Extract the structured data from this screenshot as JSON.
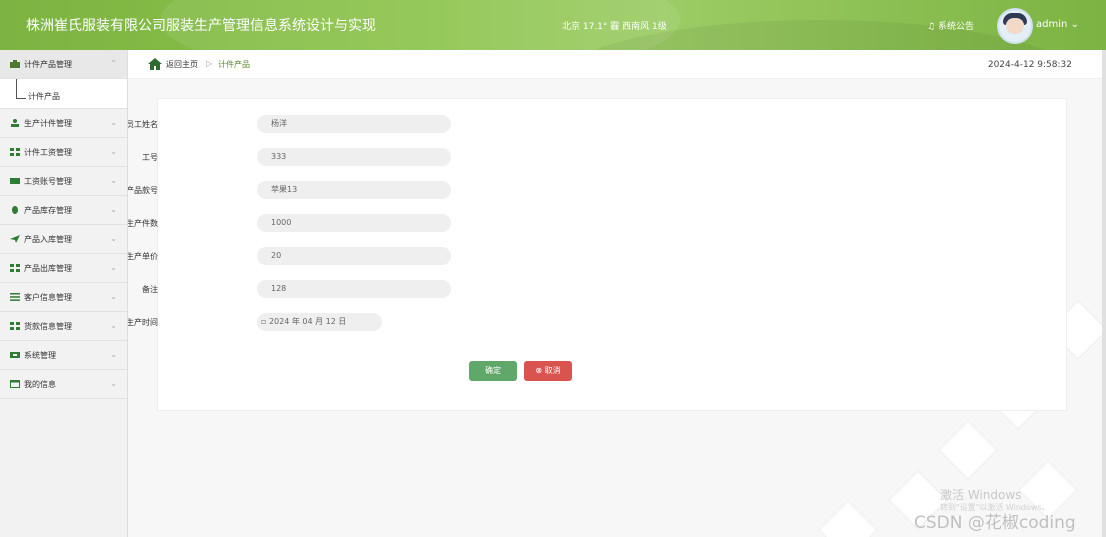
{
  "header": {
    "title": "株洲崔氏服装有限公司服装生产管理信息系统设计与实现",
    "weather": "北京  17.1°  霾  西南风  1级",
    "notice": "系统公告",
    "user": "admin ⌄"
  },
  "sidebar": {
    "items": [
      {
        "label": "计件产品管理",
        "icon": "product-icon",
        "color": "#4a7a2a"
      },
      {
        "label": "生产计件管理",
        "icon": "person-icon",
        "color": "#2e7d32"
      },
      {
        "label": "计件工资管理",
        "icon": "grid-icon",
        "color": "#2e7d32"
      },
      {
        "label": "工资账号管理",
        "icon": "card-icon",
        "color": "#2e7d32"
      },
      {
        "label": "产品库存管理",
        "icon": "leaf-icon",
        "color": "#2e7d32"
      },
      {
        "label": "产品入库管理",
        "icon": "send-icon",
        "color": "#2e7d32"
      },
      {
        "label": "产品出库管理",
        "icon": "grid-icon",
        "color": "#2e7d32"
      },
      {
        "label": "客户信息管理",
        "icon": "list-icon",
        "color": "#2e7d32"
      },
      {
        "label": "货款信息管理",
        "icon": "grid-icon",
        "color": "#2e7d32"
      },
      {
        "label": "系统管理",
        "icon": "settings-icon",
        "color": "#2e7d32"
      },
      {
        "label": "我的信息",
        "icon": "info-icon",
        "color": "#2e7d32"
      }
    ],
    "submenu": "计件产品"
  },
  "breadcrumb": {
    "home": "返回主页",
    "sep": "▷",
    "current": "计件产品",
    "time": "2024-4-12 9:58:32"
  },
  "form": {
    "fields": [
      {
        "label": "员工姓名",
        "value": "杨洋"
      },
      {
        "label": "工号",
        "value": "333"
      },
      {
        "label": "产品款号",
        "value": "苹果13"
      },
      {
        "label": "生产件数",
        "value": "1000"
      },
      {
        "label": "生产单价",
        "value": "20"
      },
      {
        "label": "备注",
        "value": "128"
      },
      {
        "label": "生产时间",
        "value": "2024 年 04 月 12 日"
      }
    ],
    "ok": "确定",
    "cancel": "⊗ 取消"
  },
  "watermark": {
    "activate": "激活 Windows",
    "activate_sub": "转到\"设置\"以激活 Windows。",
    "csdn": "CSDN @花椒coding"
  }
}
